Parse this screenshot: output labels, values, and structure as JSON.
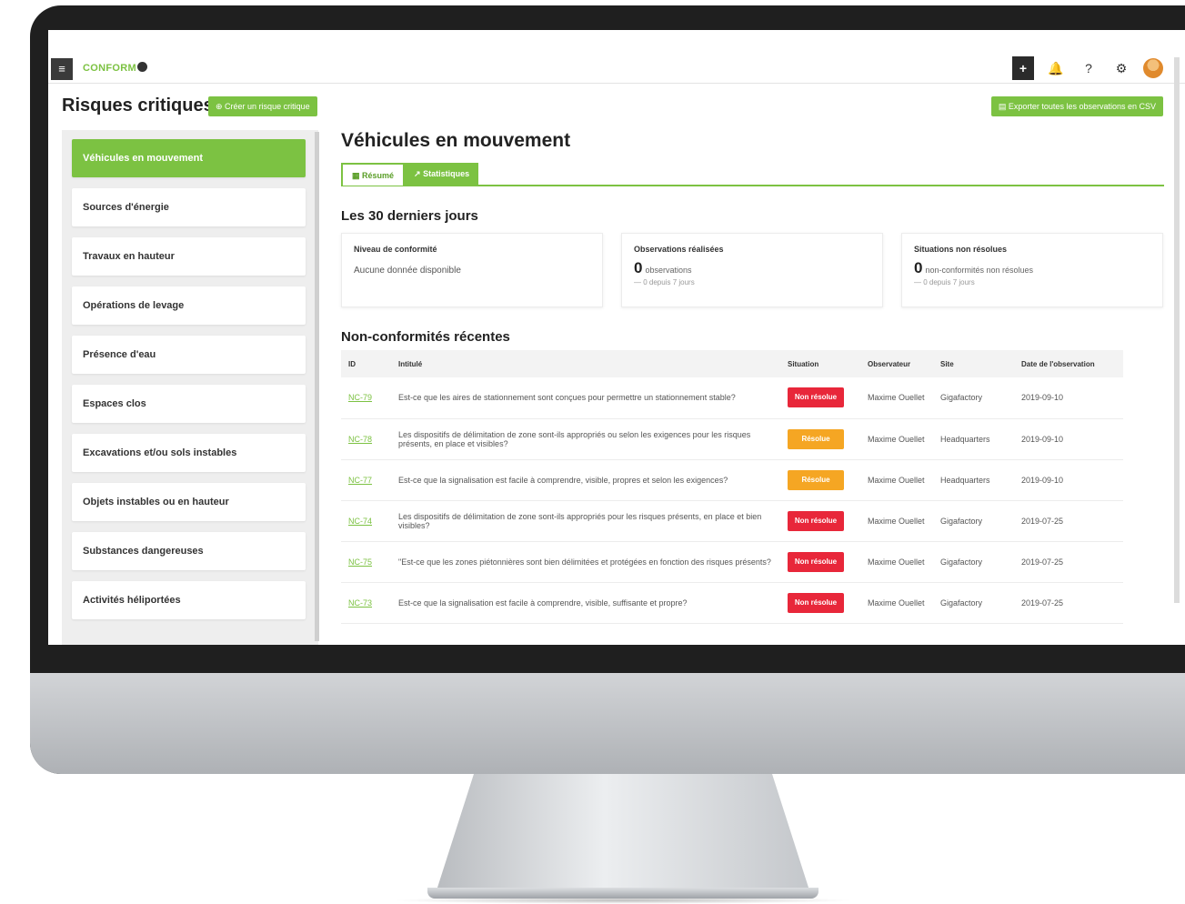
{
  "brand": {
    "name": "CONFORM"
  },
  "topbar": {
    "icons": [
      "plus-icon",
      "bell-icon",
      "help-icon",
      "gear-icon",
      "avatar"
    ],
    "plus": "+",
    "bell": "🔔",
    "help": "?",
    "gear": "⚙"
  },
  "header": {
    "title": "Risques critiques",
    "create_label": "Créer un risque critique",
    "export_label": "Exporter toutes les observations en CSV"
  },
  "sidebar": {
    "items": [
      {
        "label": "Véhicules en mouvement",
        "active": true
      },
      {
        "label": "Sources d'énergie"
      },
      {
        "label": "Travaux en hauteur"
      },
      {
        "label": "Opérations de levage"
      },
      {
        "label": "Présence d'eau"
      },
      {
        "label": "Espaces clos"
      },
      {
        "label": "Excavations et/ou sols instables"
      },
      {
        "label": "Objets instables ou en hauteur"
      },
      {
        "label": "Substances dangereuses"
      },
      {
        "label": "Activités héliportées"
      }
    ]
  },
  "main": {
    "title": "Véhicules en mouvement",
    "tabs": [
      {
        "label": "Résumé",
        "icon": "summary-icon"
      },
      {
        "label": "Statistiques",
        "icon": "chart-line-icon"
      }
    ],
    "period_title": "Les 30 derniers jours",
    "cards": [
      {
        "label": "Niveau de conformité",
        "text": "Aucune donnée disponible"
      },
      {
        "label": "Observations réalisées",
        "value": "0",
        "unit": "observations",
        "delta": "— 0 depuis 7 jours"
      },
      {
        "label": "Situations non résolues",
        "value": "0",
        "unit": "non-conformités non résolues",
        "delta": "— 0 depuis 7 jours"
      }
    ],
    "nc_title": "Non-conformités récentes",
    "table": {
      "headers": [
        "ID",
        "Intitulé",
        "Situation",
        "Observateur",
        "Site",
        "Date de l'observation"
      ],
      "rows": [
        {
          "id": "NC-79",
          "title": "Est-ce que les aires de stationnement sont conçues pour permettre un stationnement stable?",
          "status": "Non résolue",
          "color": "#e8273a",
          "observer": "Maxime Ouellet",
          "site": "Gigafactory",
          "date": "2019-09-10"
        },
        {
          "id": "NC-78",
          "title": "Les dispositifs de délimitation de zone sont-ils appropriés ou selon les exigences pour les risques présents, en place et visibles?",
          "status": "Résolue",
          "color": "#f5a623",
          "observer": "Maxime Ouellet",
          "site": "Headquarters",
          "date": "2019-09-10"
        },
        {
          "id": "NC-77",
          "title": "Est-ce que la signalisation est facile à comprendre, visible, propres et selon les exigences?",
          "status": "Résolue",
          "color": "#f5a623",
          "observer": "Maxime Ouellet",
          "site": "Headquarters",
          "date": "2019-09-10"
        },
        {
          "id": "NC-74",
          "title": "Les dispositifs de délimitation de zone sont-ils appropriés pour les risques présents, en place et bien visibles?",
          "status": "Non résolue",
          "color": "#e8273a",
          "observer": "Maxime Ouellet",
          "site": "Gigafactory",
          "date": "2019-07-25"
        },
        {
          "id": "NC-75",
          "title": "\"Est-ce que les zones piétonnières sont bien délimitées et protégées en fonction des risques présents?",
          "status": "Non résolue",
          "color": "#e8273a",
          "observer": "Maxime Ouellet",
          "site": "Gigafactory",
          "date": "2019-07-25"
        },
        {
          "id": "NC-73",
          "title": "Est-ce que la signalisation est facile à comprendre, visible, suffisante et propre?",
          "status": "Non résolue",
          "color": "#e8273a",
          "observer": "Maxime Ouellet",
          "site": "Gigafactory",
          "date": "2019-07-25"
        }
      ]
    }
  },
  "colors": {
    "accent": "#7cc242",
    "danger": "#e8273a",
    "warning": "#f5a623"
  }
}
